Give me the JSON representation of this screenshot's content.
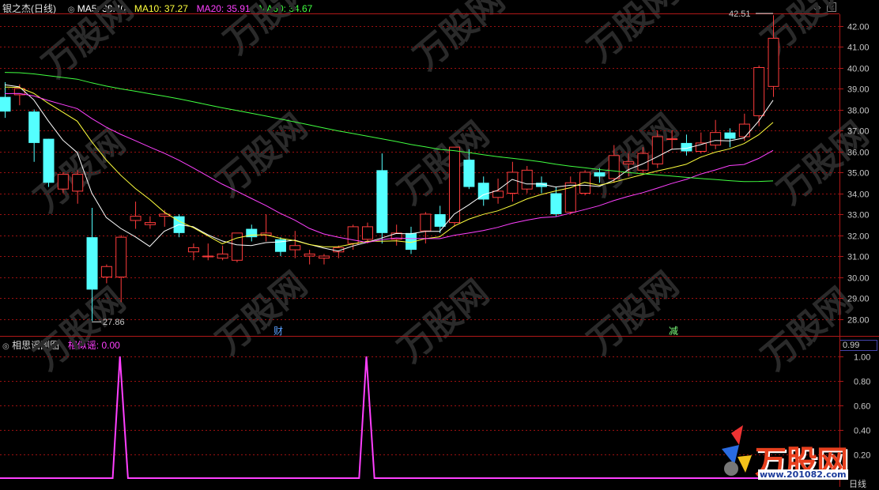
{
  "header": {
    "title": "银之杰(日线)",
    "ma5": "MA5: 38.40",
    "ma10": "MA10: 37.27",
    "ma20": "MA20: 35.91",
    "ma60": "MA60: 34.67"
  },
  "indicator": {
    "title": "相思谣副图",
    "similarity": "相似谣: 0.00",
    "value_box": "0.99",
    "y_ticks": [
      "1.00",
      "0.80",
      "0.60",
      "0.40",
      "0.20"
    ]
  },
  "markers": {
    "cai": "财",
    "jian": "减"
  },
  "annotations": {
    "high": "42.51",
    "low": "27.86"
  },
  "bottom": {
    "period": "日线"
  },
  "watermark": {
    "text": "万股网",
    "url": "www.201082.com"
  },
  "logo": {
    "text": "万股网",
    "url": "www.201082.com"
  },
  "colors": {
    "up": "#ff3c3c",
    "down": "#54ffff",
    "ma5": "#ffffff",
    "ma10": "#ffff3c",
    "ma20": "#ff40ff",
    "ma60": "#40ff40",
    "grid": "#9b1010",
    "indicator": "#ff40ff"
  },
  "chart_data": [
    {
      "type": "candlestick",
      "title": "银之杰(日线)",
      "ylim": [
        27.4,
        42.6
      ],
      "y_ticks": [
        28,
        29,
        30,
        31,
        32,
        33,
        34,
        35,
        36,
        37,
        38,
        39,
        40,
        41,
        42
      ],
      "candles": [
        [
          38.6,
          39.3,
          37.6,
          37.9
        ],
        [
          38.7,
          39.2,
          38.2,
          39.0
        ],
        [
          37.9,
          38.0,
          35.5,
          36.4
        ],
        [
          36.6,
          36.6,
          34.3,
          34.5
        ],
        [
          34.2,
          35.0,
          34.0,
          34.9
        ],
        [
          34.1,
          35.1,
          33.5,
          34.9
        ],
        [
          31.9,
          33.3,
          27.9,
          29.4
        ],
        [
          30.0,
          30.6,
          29.7,
          30.5
        ],
        [
          30.0,
          32.0,
          28.8,
          31.9
        ],
        [
          32.7,
          33.6,
          32.3,
          32.9
        ],
        [
          32.5,
          32.9,
          32.3,
          32.6
        ],
        [
          32.9,
          33.2,
          32.4,
          33.0
        ],
        [
          32.9,
          33.0,
          31.9,
          32.1
        ],
        [
          31.2,
          31.6,
          30.8,
          31.4
        ],
        [
          31.0,
          31.6,
          30.8,
          31.0
        ],
        [
          30.9,
          31.5,
          30.8,
          31.1
        ],
        [
          30.8,
          32.1,
          30.7,
          32.1
        ],
        [
          32.3,
          32.5,
          31.7,
          31.9
        ],
        [
          32.0,
          33.0,
          31.7,
          32.1
        ],
        [
          31.8,
          31.9,
          31.0,
          31.2
        ],
        [
          31.3,
          32.2,
          30.9,
          31.5
        ],
        [
          31.0,
          31.3,
          30.6,
          31.1
        ],
        [
          30.9,
          31.1,
          30.6,
          31.0
        ],
        [
          31.2,
          31.5,
          30.9,
          31.4
        ],
        [
          31.6,
          32.5,
          31.3,
          32.4
        ],
        [
          31.8,
          32.6,
          31.6,
          32.4
        ],
        [
          35.1,
          35.9,
          31.6,
          32.1
        ],
        [
          31.8,
          32.5,
          31.5,
          32.1
        ],
        [
          32.1,
          32.4,
          31.1,
          31.3
        ],
        [
          32.2,
          33.1,
          31.6,
          33.0
        ],
        [
          33.0,
          33.4,
          32.1,
          32.4
        ],
        [
          32.6,
          36.1,
          32.4,
          36.2
        ],
        [
          35.6,
          36.1,
          34.2,
          34.3
        ],
        [
          34.5,
          34.8,
          33.4,
          33.7
        ],
        [
          33.8,
          34.7,
          33.5,
          34.1
        ],
        [
          34.0,
          35.5,
          33.6,
          35.0
        ],
        [
          34.2,
          35.3,
          34.0,
          35.1
        ],
        [
          34.5,
          34.8,
          34.0,
          34.3
        ],
        [
          34.0,
          34.3,
          32.9,
          33.0
        ],
        [
          33.1,
          34.8,
          33.0,
          34.5
        ],
        [
          34.0,
          35.1,
          33.9,
          35.0
        ],
        [
          35.0,
          35.2,
          34.5,
          34.8
        ],
        [
          34.7,
          36.3,
          34.5,
          35.8
        ],
        [
          35.4,
          35.9,
          34.8,
          35.5
        ],
        [
          35.1,
          36.2,
          34.9,
          35.9
        ],
        [
          35.4,
          37.0,
          35.2,
          36.7
        ],
        [
          36.6,
          37.0,
          36.1,
          36.6
        ],
        [
          36.4,
          36.8,
          35.8,
          36.0
        ],
        [
          36.0,
          36.9,
          35.9,
          36.4
        ],
        [
          36.3,
          37.5,
          36.1,
          36.9
        ],
        [
          36.9,
          37.1,
          36.2,
          36.6
        ],
        [
          36.7,
          37.8,
          36.5,
          37.3
        ],
        [
          37.7,
          40.1,
          37.2,
          40.0
        ],
        [
          39.1,
          42.5,
          38.6,
          41.4
        ]
      ],
      "ma": [
        {
          "name": "MA5",
          "color": "#ffffff"
        },
        {
          "name": "MA10",
          "color": "#ffff3c"
        },
        {
          "name": "MA20",
          "color": "#ff40ff"
        },
        {
          "name": "MA60",
          "color": "#40ff40"
        }
      ],
      "annotations": [
        {
          "label": "42.51",
          "type": "high"
        },
        {
          "label": "27.86",
          "type": "low"
        }
      ]
    },
    {
      "type": "line",
      "title": "相思谣副图",
      "ylim": [
        0,
        1
      ],
      "y_ticks": [
        0.2,
        0.4,
        0.6,
        0.8,
        1.0
      ],
      "series": [
        {
          "name": "相似谣",
          "color": "#ff40ff",
          "pulses_at_candle_index": [
            8,
            25
          ]
        }
      ]
    }
  ]
}
